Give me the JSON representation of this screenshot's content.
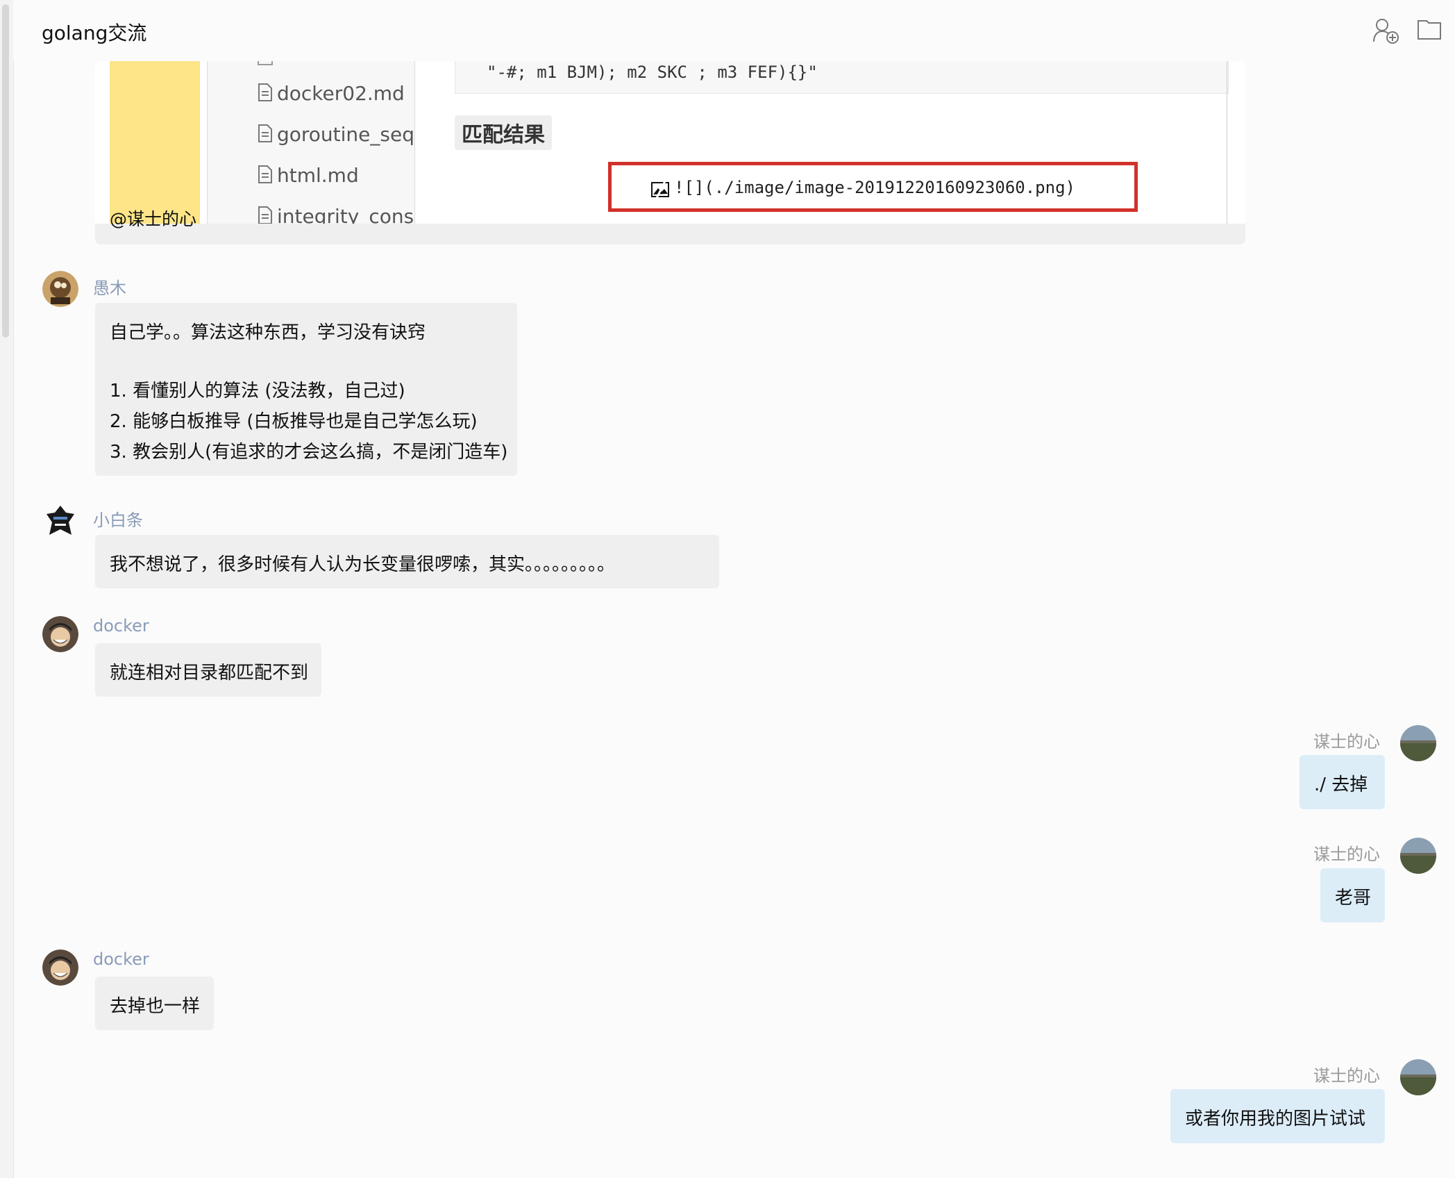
{
  "header": {
    "title": "golang交流",
    "add_member_icon": "add-user-icon",
    "folder_icon": "folder-icon"
  },
  "image_message": {
    "mention_label": "@谋士的心",
    "files": [
      "docker02.md",
      "goroutine_sequ",
      "html.md",
      "integrity_const"
    ],
    "code_snippet": "\"-#; m1 BJM); m2 SKC ; m3 FEF){}\"",
    "match_heading": "匹配结果",
    "markdown_text": "![](./image/image-20191220160923060.png)"
  },
  "messages": [
    {
      "sender": "愚木",
      "lines": [
        "自己学。。算法这种东西，学习没有诀窍",
        "",
        "1. 看懂别人的算法 (没法教，自己过)",
        "2. 能够白板推导 (白板推导也是自己学怎么玩)",
        "3. 教会别人(有追求的才会这么搞，不是闭门造车)"
      ]
    },
    {
      "sender": "小白条",
      "text": "我不想说了，很多时候有人认为长变量很啰嗦，其实。。。。。。。。。"
    },
    {
      "sender": "docker",
      "text": "就连相对目录都匹配不到"
    },
    {
      "sender": "谋士的心",
      "text": "./ 去掉"
    },
    {
      "sender": "谋士的心",
      "text": "老哥"
    },
    {
      "sender": "docker",
      "text": "去掉也一样"
    },
    {
      "sender": "谋士的心",
      "text": "或者你用我的图片试试"
    }
  ],
  "colors": {
    "other_bubble": "#efefef",
    "own_bubble": "#dcedf8",
    "sender_name_other": "#8a9bb8",
    "sender_name_self": "#9a9a9a",
    "highlight_border": "#d2302a",
    "sticky_yellow": "#fde588"
  }
}
